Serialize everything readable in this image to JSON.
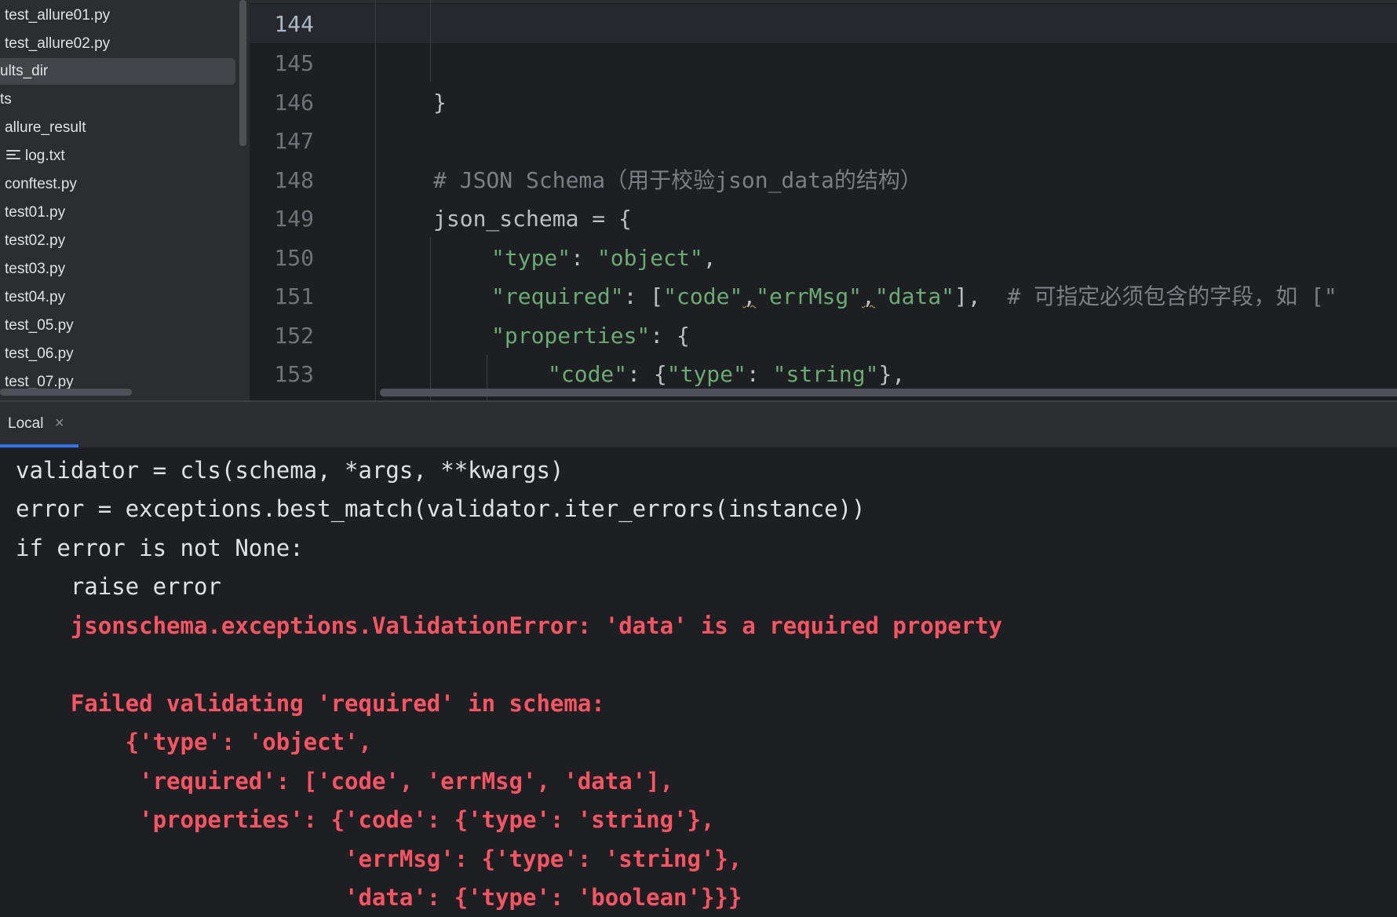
{
  "sidebar": {
    "items": [
      {
        "label": "test_allure01.py"
      },
      {
        "label": "test_allure02.py"
      },
      {
        "label": "ults_dir",
        "selected": true
      },
      {
        "label": "ts"
      },
      {
        "label": "allure_result"
      },
      {
        "label": "log.txt",
        "icon": "text-file-icon"
      },
      {
        "label": "conftest.py"
      },
      {
        "label": "test01.py"
      },
      {
        "label": "test02.py"
      },
      {
        "label": "test03.py"
      },
      {
        "label": "test04.py"
      },
      {
        "label": "test_05.py"
      },
      {
        "label": "test_06.py"
      },
      {
        "label": "test_07.py"
      }
    ]
  },
  "editor": {
    "current_line": "144",
    "lines": [
      {
        "num": "144",
        "t1": ""
      },
      {
        "num": "145",
        "t1": ""
      },
      {
        "num": "146",
        "t1": "}"
      },
      {
        "num": "147",
        "t1": ""
      },
      {
        "num": "148",
        "comment": "# JSON Schema（用于校验json_data的结构）"
      },
      {
        "num": "149",
        "t1": "json_schema = {"
      },
      {
        "num": "150",
        "s1": "\"type\"",
        "p1": ": ",
        "s2": "\"object\"",
        "p2": ","
      },
      {
        "num": "151",
        "s1": "\"required\"",
        "p1": ": [",
        "s2": "\"code\"",
        "p2": ",",
        "s3": "\"errMsg\"",
        "p3": ",",
        "s4": "\"data\"",
        "p4": "],  ",
        "comment": "# 可指定必须包含的字段，如 [\""
      },
      {
        "num": "152",
        "s1": "\"properties\"",
        "p1": ": {"
      },
      {
        "num": "153",
        "s1": "\"code\"",
        "p1": ": {",
        "s2": "\"type\"",
        "p2": ": ",
        "s3": "\"string\"",
        "p3": "},"
      }
    ]
  },
  "terminal": {
    "tab_label": "Local",
    "close_glyph": "×",
    "lines": [
      {
        "text": "validator = cls(schema, *args, **kwargs)",
        "error": false
      },
      {
        "text": "error = exceptions.best_match(validator.iter_errors(instance))",
        "error": false
      },
      {
        "text": "if error is not None:",
        "error": false
      },
      {
        "text": "    raise error",
        "error": false
      },
      {
        "text": "    jsonschema.exceptions.ValidationError: 'data' is a required property",
        "error": true
      },
      {
        "text": "",
        "error": true
      },
      {
        "text": "    Failed validating 'required' in schema:",
        "error": true
      },
      {
        "text": "        {'type': 'object',",
        "error": true
      },
      {
        "text": "         'required': ['code', 'errMsg', 'data'],",
        "error": true
      },
      {
        "text": "         'properties': {'code': {'type': 'string'},",
        "error": true
      },
      {
        "text": "                        'errMsg': {'type': 'string'},",
        "error": true
      },
      {
        "text": "                        'data': {'type': 'boolean'}}}",
        "error": true
      }
    ]
  },
  "colors": {
    "error_text": "#f75464",
    "string": "#6aab73",
    "comment": "#7a7e85",
    "accent": "#3574f0"
  }
}
